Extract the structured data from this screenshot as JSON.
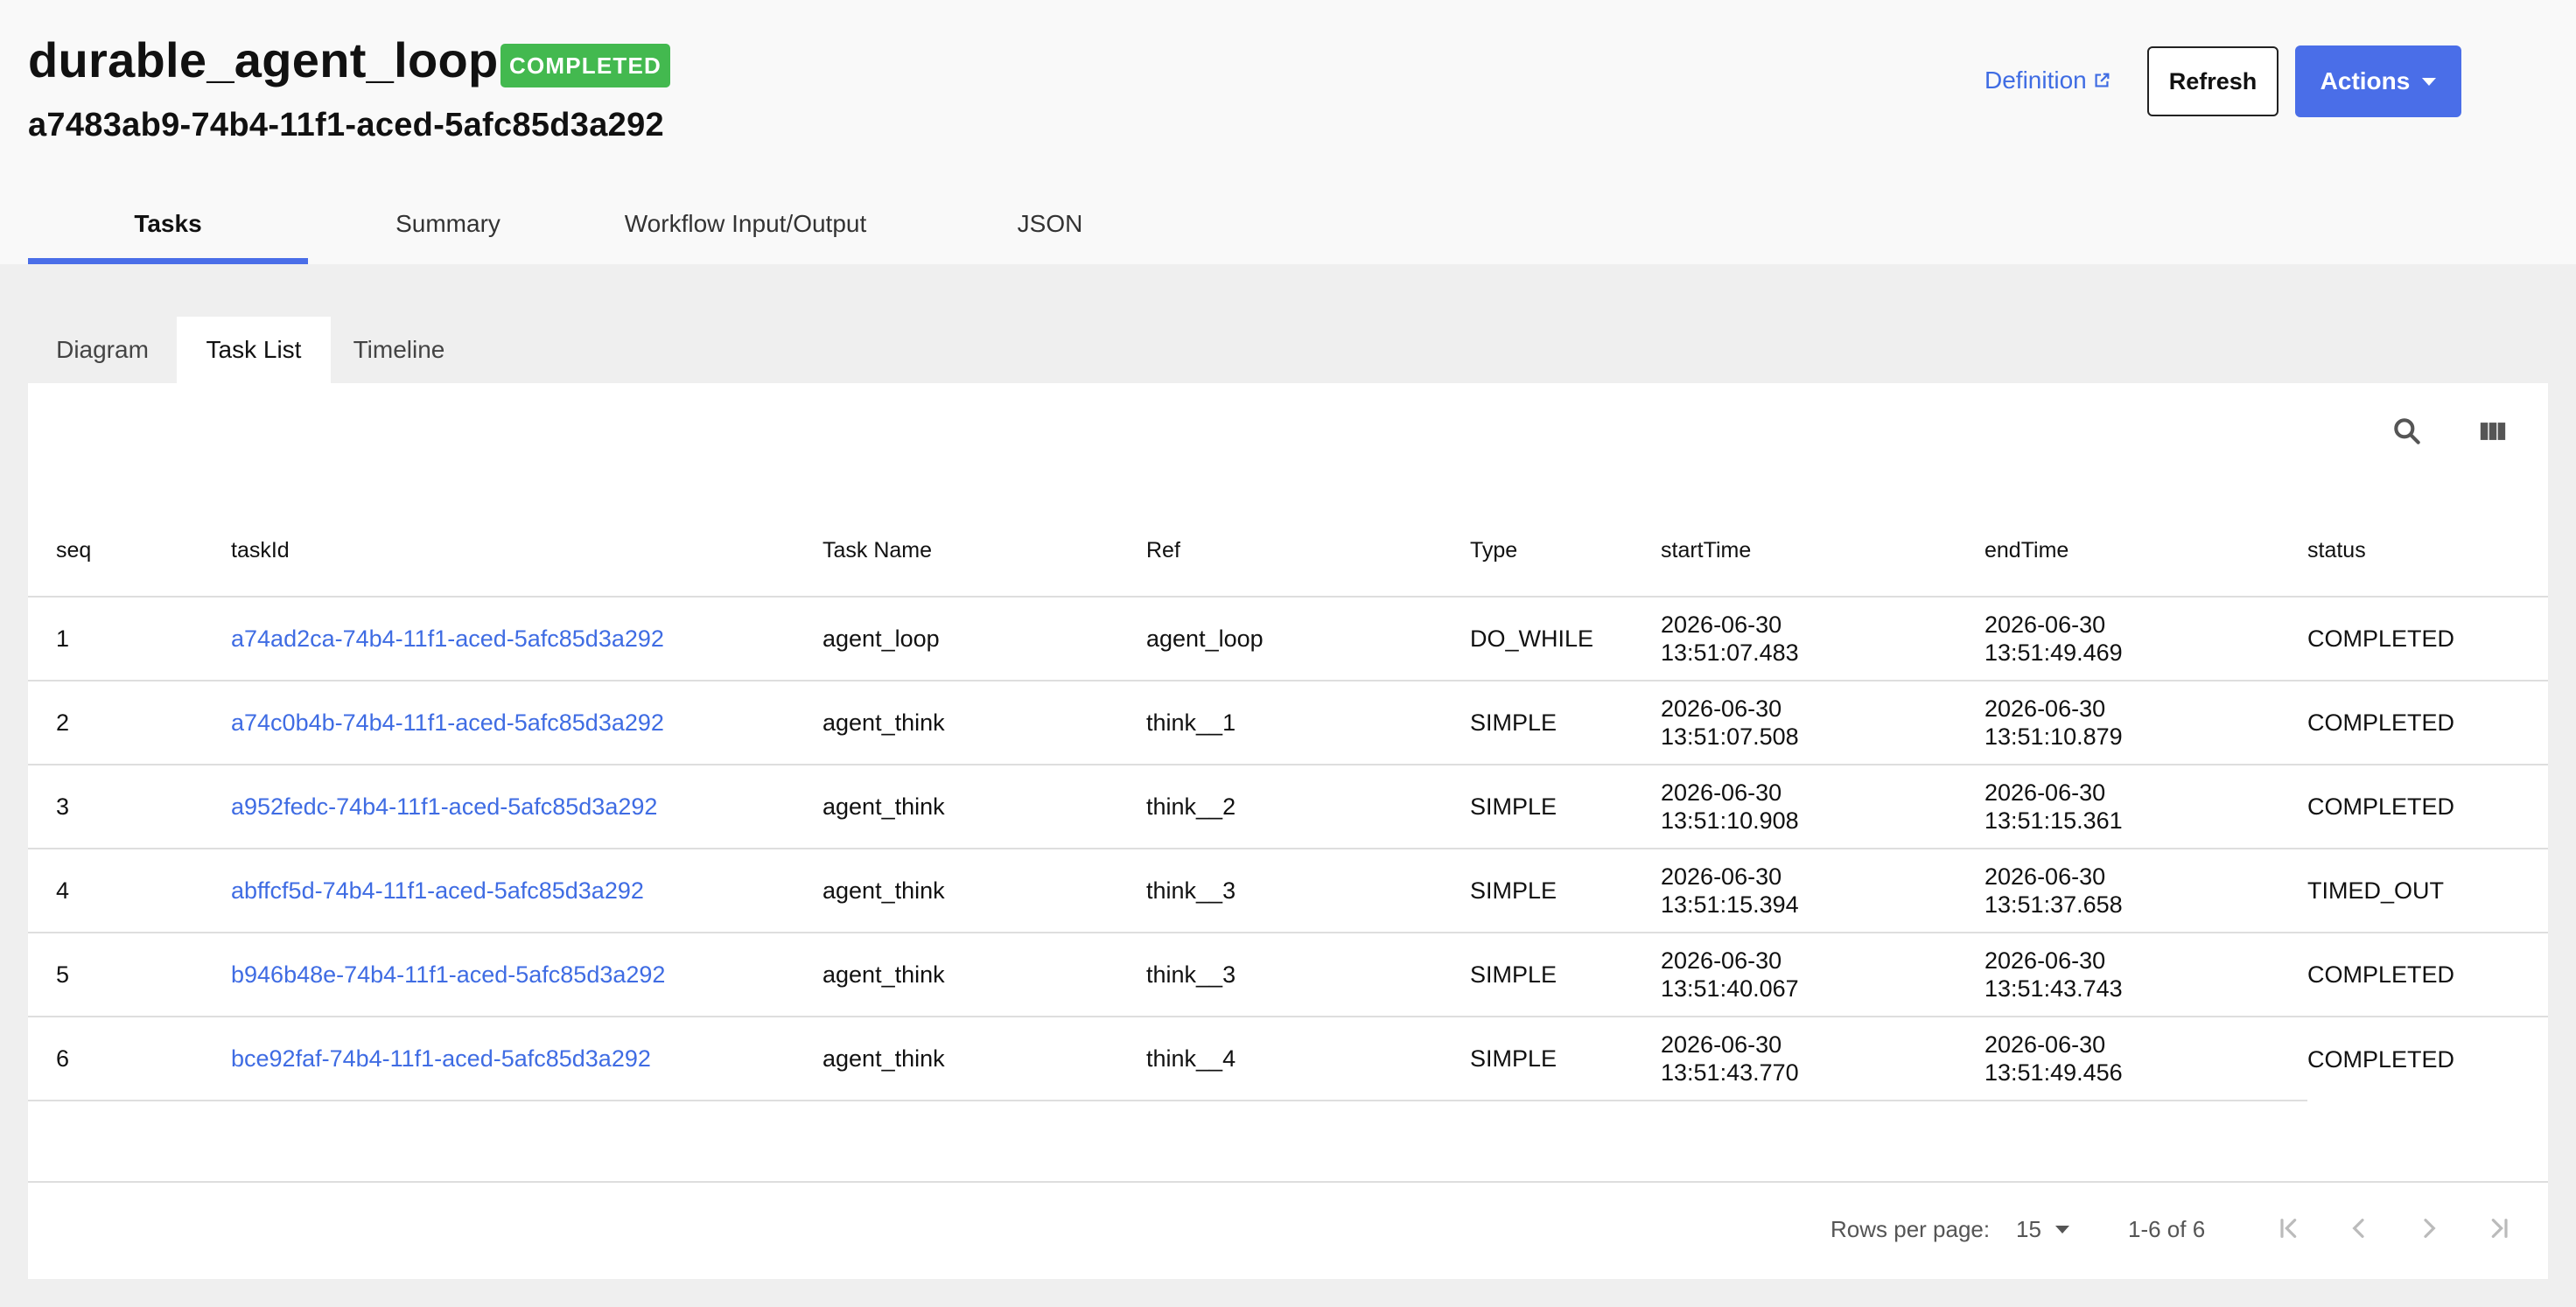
{
  "workflow": {
    "name": "durable_agent_loop",
    "status_badge": "COMPLETED",
    "id": "a7483ab9-74b4-11f1-aced-5afc85d3a292",
    "badge_color": "#43b94f"
  },
  "header_actions": {
    "definition_label": "Definition",
    "refresh_label": "Refresh",
    "actions_label": "Actions"
  },
  "main_tabs": [
    {
      "label": "Tasks",
      "active": true
    },
    {
      "label": "Summary",
      "active": false
    },
    {
      "label": "Workflow Input/Output",
      "active": false
    },
    {
      "label": "JSON",
      "active": false
    }
  ],
  "sub_tabs": [
    {
      "label": "Diagram",
      "active": false
    },
    {
      "label": "Task List",
      "active": true
    },
    {
      "label": "Timeline",
      "active": false
    }
  ],
  "toolbar_icons": [
    "search-icon",
    "view-columns-icon"
  ],
  "table": {
    "columns": [
      "seq",
      "taskId",
      "Task Name",
      "Ref",
      "Type",
      "startTime",
      "endTime",
      "status"
    ],
    "rows": [
      {
        "seq": "1",
        "taskId": "a74ad2ca-74b4-11f1-aced-5afc85d3a292",
        "task_name": "agent_loop",
        "ref": "agent_loop",
        "type": "DO_WHILE",
        "start_date": "2026-06-30",
        "start_time": "13:51:07.483",
        "end_date": "2026-06-30",
        "end_time": "13:51:49.469",
        "status": "COMPLETED"
      },
      {
        "seq": "2",
        "taskId": "a74c0b4b-74b4-11f1-aced-5afc85d3a292",
        "task_name": "agent_think",
        "ref": "think__1",
        "type": "SIMPLE",
        "start_date": "2026-06-30",
        "start_time": "13:51:07.508",
        "end_date": "2026-06-30",
        "end_time": "13:51:10.879",
        "status": "COMPLETED"
      },
      {
        "seq": "3",
        "taskId": "a952fedc-74b4-11f1-aced-5afc85d3a292",
        "task_name": "agent_think",
        "ref": "think__2",
        "type": "SIMPLE",
        "start_date": "2026-06-30",
        "start_time": "13:51:10.908",
        "end_date": "2026-06-30",
        "end_time": "13:51:15.361",
        "status": "COMPLETED"
      },
      {
        "seq": "4",
        "taskId": "abffcf5d-74b4-11f1-aced-5afc85d3a292",
        "task_name": "agent_think",
        "ref": "think__3",
        "type": "SIMPLE",
        "start_date": "2026-06-30",
        "start_time": "13:51:15.394",
        "end_date": "2026-06-30",
        "end_time": "13:51:37.658",
        "status": "TIMED_OUT"
      },
      {
        "seq": "5",
        "taskId": "b946b48e-74b4-11f1-aced-5afc85d3a292",
        "task_name": "agent_think",
        "ref": "think__3",
        "type": "SIMPLE",
        "start_date": "2026-06-30",
        "start_time": "13:51:40.067",
        "end_date": "2026-06-30",
        "end_time": "13:51:43.743",
        "status": "COMPLETED"
      },
      {
        "seq": "6",
        "taskId": "bce92faf-74b4-11f1-aced-5afc85d3a292",
        "task_name": "agent_think",
        "ref": "think__4",
        "type": "SIMPLE",
        "start_date": "2026-06-30",
        "start_time": "13:51:43.770",
        "end_date": "2026-06-30",
        "end_time": "13:51:49.456",
        "status": "COMPLETED"
      }
    ]
  },
  "pagination": {
    "rows_per_page_label": "Rows per page:",
    "rows_per_page": "15",
    "range": "1-6 of 6"
  },
  "colors": {
    "accent": "#4a6ee8",
    "link": "#3f6ce3",
    "success": "#43b94f"
  }
}
